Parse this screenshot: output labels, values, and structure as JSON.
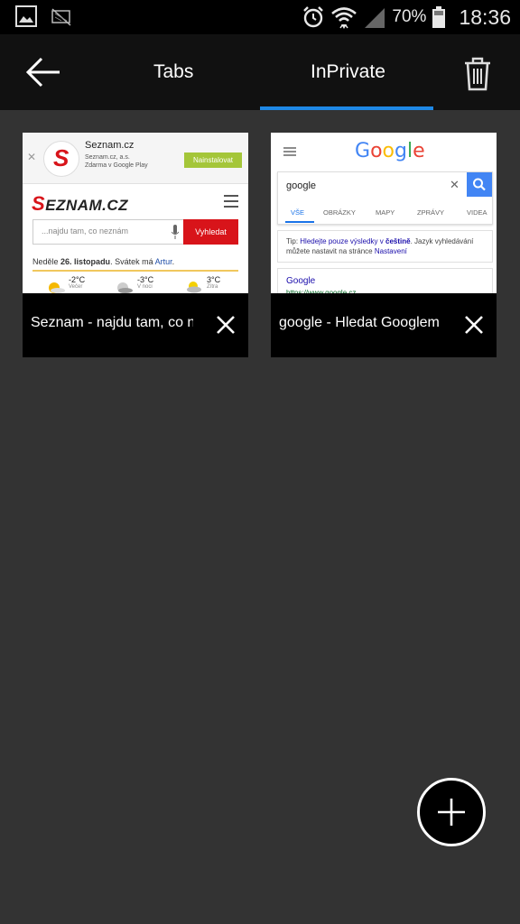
{
  "status_bar": {
    "battery": "70%",
    "time": "18:36",
    "icons": [
      "gallery-icon",
      "sim-off-icon",
      "alarm-icon",
      "wifi-icon",
      "signal-icon",
      "battery-icon"
    ]
  },
  "toolbar": {
    "back_icon": "arrow-left-icon",
    "tabs_label": "Tabs",
    "inprivate_label": "InPrivate",
    "trash_icon": "trash-icon",
    "active_tab": "InPrivate",
    "accent": "#1e88e5"
  },
  "tabs": [
    {
      "title": "Seznam - najdu tam, co neznám",
      "preview": {
        "app_banner": {
          "name": "Seznam.cz",
          "publisher": "Seznam.cz, a.s.",
          "store": "Zdarma v Google Play",
          "install": "Nainstalovat"
        },
        "logo_first": "S",
        "logo_rest": "EZNAM.CZ",
        "search_placeholder": "...najdu tam, co neznám",
        "search_button": "Vyhledat",
        "date_prefix": "Neděle",
        "date_bold": "26. listopadu",
        "date_mid": ". Svátek má",
        "date_name": "Artur",
        "weather": [
          {
            "temp": "-2°C",
            "label": "Večer"
          },
          {
            "temp": "-3°C",
            "label": "V noci"
          },
          {
            "temp": "3°C",
            "label": "Zítra"
          }
        ]
      }
    },
    {
      "title": "google - Hledat Googlem",
      "preview": {
        "search_value": "google",
        "tabs": [
          "VŠE",
          "OBRÁZKY",
          "MAPY",
          "ZPRÁVY",
          "VIDEA"
        ],
        "tip_prefix": "Tip:",
        "tip_link1": "Hledejte pouze výsledky v",
        "tip_link_bold": "češtině",
        "tip_mid": ". Jazyk vyhledávání můžete nastavit na stránce",
        "tip_link2": "Nastavení",
        "result_title": "Google",
        "result_url": "https://www.google.cz"
      }
    }
  ],
  "fab_icon": "plus-icon"
}
